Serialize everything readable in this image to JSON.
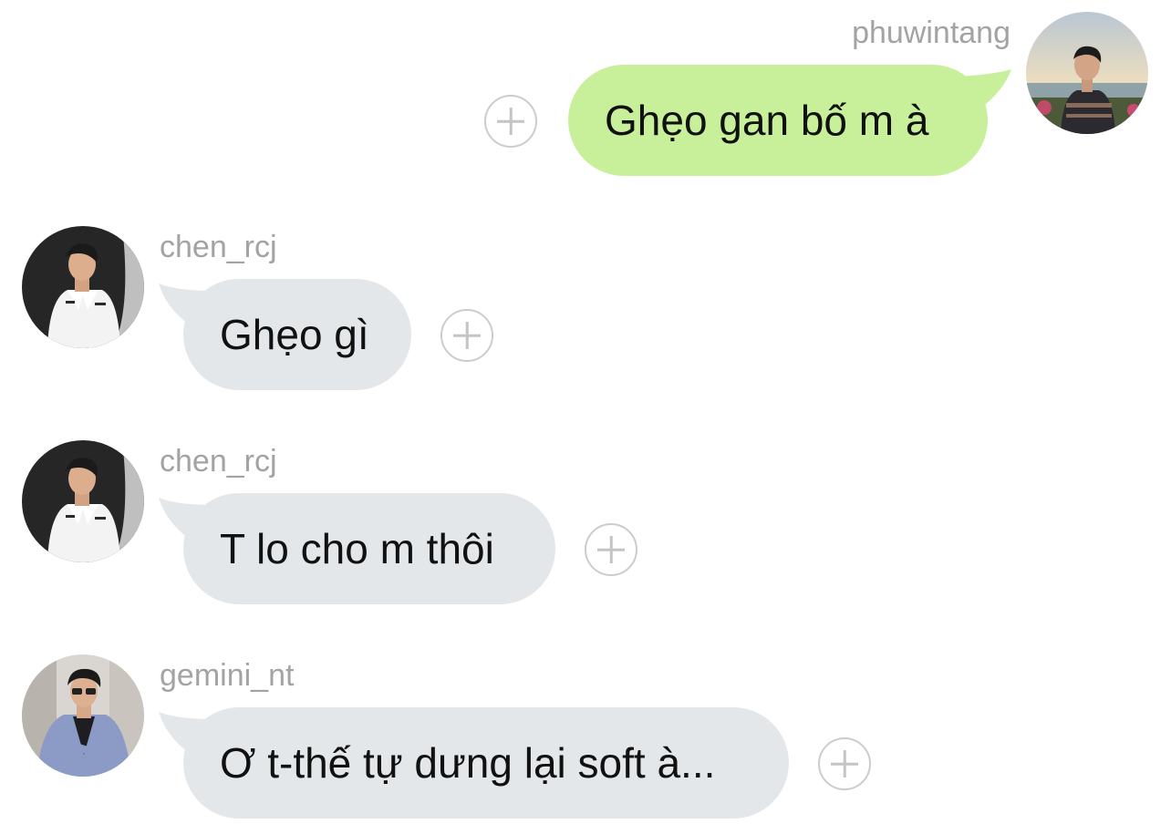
{
  "colors": {
    "outgoing_bubble": "#c8f09a",
    "incoming_bubble": "#e4e7ea",
    "username": "#a3a3a3",
    "add_button": "#cccccc"
  },
  "messages": [
    {
      "direction": "outgoing",
      "username": "phuwintang",
      "text": "Ghẹo gan bố m à",
      "avatar_icon": "user-avatar-photo"
    },
    {
      "direction": "incoming",
      "username": "chen_rcj",
      "text": "Ghẹo gì",
      "avatar_icon": "user-avatar-photo"
    },
    {
      "direction": "incoming",
      "username": "chen_rcj",
      "text": "T lo cho m thôi",
      "avatar_icon": "user-avatar-photo"
    },
    {
      "direction": "incoming",
      "username": "gemini_nt",
      "text": "Ơ t-thế tự dưng lại soft à...",
      "avatar_icon": "user-avatar-photo"
    }
  ],
  "react_button_icon": "plus-circle-icon"
}
